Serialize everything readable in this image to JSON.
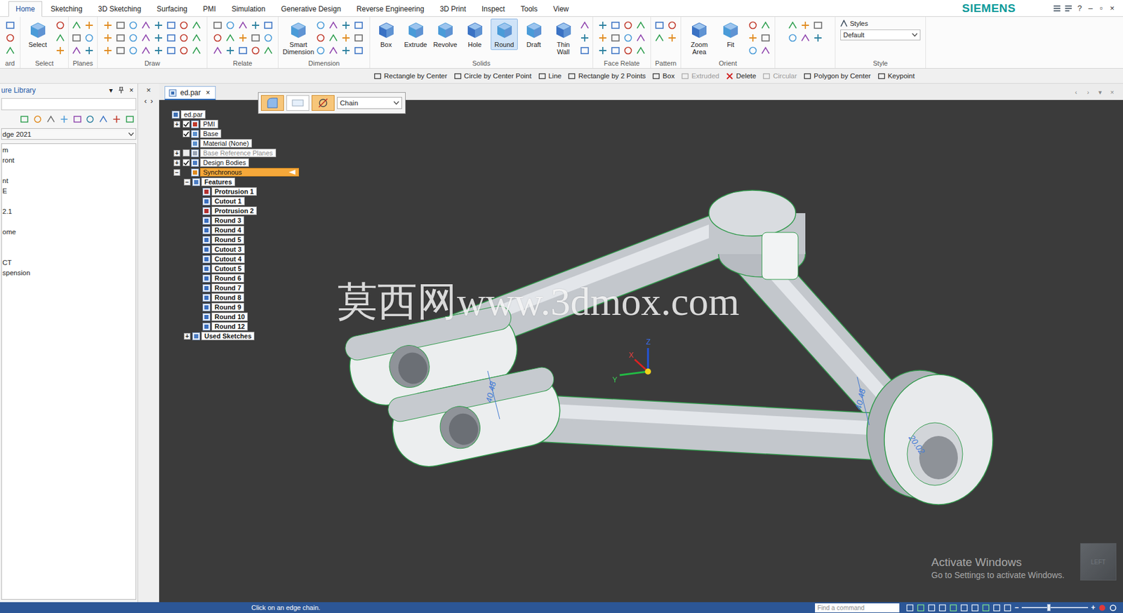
{
  "window": {
    "brand": "SIEMENS",
    "controls": [
      "?",
      "–",
      "▫",
      "×"
    ]
  },
  "ribbon_tabs": [
    {
      "label": "Home",
      "selected": true
    },
    {
      "label": "Sketching",
      "selected": false
    },
    {
      "label": "3D Sketching",
      "selected": false
    },
    {
      "label": "Surfacing",
      "selected": false
    },
    {
      "label": "PMI",
      "selected": false
    },
    {
      "label": "Simulation",
      "selected": false
    },
    {
      "label": "Generative Design",
      "selected": false
    },
    {
      "label": "Reverse Engineering",
      "selected": false
    },
    {
      "label": "3D Print",
      "selected": false
    },
    {
      "label": "Inspect",
      "selected": false
    },
    {
      "label": "Tools",
      "selected": false
    },
    {
      "label": "View",
      "selected": false
    }
  ],
  "ribbon_groups": [
    {
      "label": "ard",
      "buttons": []
    },
    {
      "label": "Select",
      "buttons": [
        {
          "label": "Select",
          "selected": false
        }
      ]
    },
    {
      "label": "Planes",
      "buttons": []
    },
    {
      "label": "Draw",
      "buttons": []
    },
    {
      "label": "Relate",
      "buttons": []
    },
    {
      "label": "Dimension",
      "buttons": [
        {
          "label": "Smart Dimension",
          "selected": false
        }
      ]
    },
    {
      "label": "Solids",
      "buttons": [
        {
          "label": "Box",
          "selected": false
        },
        {
          "label": "Extrude",
          "selected": false
        },
        {
          "label": "Revolve",
          "selected": false
        },
        {
          "label": "Hole",
          "selected": false
        },
        {
          "label": "Round",
          "selected": true
        },
        {
          "label": "Draft",
          "selected": false
        },
        {
          "label": "Thin Wall",
          "selected": false
        }
      ]
    },
    {
      "label": "Face Relate",
      "buttons": []
    },
    {
      "label": "Pattern",
      "buttons": []
    },
    {
      "label": "Orient",
      "buttons": [
        {
          "label": "Zoom Area",
          "selected": false
        },
        {
          "label": "Fit",
          "selected": false
        }
      ]
    },
    {
      "label": "",
      "buttons": []
    }
  ],
  "style_group": {
    "label": "Style",
    "caption": "Styles",
    "value": "Default"
  },
  "command_bar": [
    {
      "label": "Rectangle by Center",
      "disabled": false
    },
    {
      "label": "Circle by Center Point",
      "disabled": false
    },
    {
      "label": "Line",
      "disabled": false
    },
    {
      "label": "Rectangle by 2 Points",
      "disabled": false
    },
    {
      "label": "Box",
      "disabled": false
    },
    {
      "label": "Extruded",
      "disabled": true
    },
    {
      "label": "Delete",
      "disabled": false
    },
    {
      "label": "Circular",
      "disabled": true
    },
    {
      "label": "Polygon by Center",
      "disabled": false
    },
    {
      "label": "Keypoint",
      "disabled": false
    }
  ],
  "library_panel": {
    "title": "ure Library",
    "controls": [
      "▾",
      "×"
    ],
    "dropdown": "dge 2021",
    "items": [
      "m",
      "ront",
      "",
      "nt",
      "E",
      "",
      "2.1",
      "",
      "ome",
      "",
      "",
      "CT",
      "spension"
    ]
  },
  "side_strip": [
    "×",
    "‹",
    "›"
  ],
  "document_tab": {
    "label": "ed.par",
    "close": "×",
    "controls": [
      "‹",
      "›",
      "▾",
      "×"
    ]
  },
  "quickbar": {
    "chain": "Chain"
  },
  "tree": [
    {
      "label": "ed.par",
      "level": 0,
      "expander": null,
      "checked": null,
      "kind": "document",
      "selected": false
    },
    {
      "label": "PMI",
      "level": 1,
      "expander": "+",
      "checked": true,
      "kind": "pmi",
      "selected": false
    },
    {
      "label": "Base",
      "level": 1,
      "expander": null,
      "checked": true,
      "kind": "base",
      "selected": false
    },
    {
      "label": "Material (None)",
      "level": 1,
      "expander": null,
      "checked": null,
      "kind": "material",
      "selected": false
    },
    {
      "label": "Base Reference Planes",
      "level": 1,
      "expander": "+",
      "checked": false,
      "kind": "planes",
      "selected": false,
      "dimmed": true
    },
    {
      "label": "Design Bodies",
      "level": 1,
      "expander": "+",
      "checked": true,
      "kind": "bodies",
      "selected": false
    },
    {
      "label": "Synchronous",
      "level": 1,
      "expander": "−",
      "checked": null,
      "kind": "synchronous",
      "selected": true
    },
    {
      "label": "Features",
      "level": 2,
      "expander": "−",
      "checked": null,
      "kind": "folder",
      "selected": false
    },
    {
      "label": "Protrusion 1",
      "level": 3,
      "expander": null,
      "checked": null,
      "kind": "protrusion",
      "selected": false
    },
    {
      "label": "Cutout 1",
      "level": 3,
      "expander": null,
      "checked": null,
      "kind": "cutout",
      "selected": false
    },
    {
      "label": "Protrusion 2",
      "level": 3,
      "expander": null,
      "checked": null,
      "kind": "protrusion",
      "selected": false
    },
    {
      "label": "Round 3",
      "level": 3,
      "expander": null,
      "checked": null,
      "kind": "round",
      "selected": false
    },
    {
      "label": "Round 4",
      "level": 3,
      "expander": null,
      "checked": null,
      "kind": "round",
      "selected": false
    },
    {
      "label": "Round 5",
      "level": 3,
      "expander": null,
      "checked": null,
      "kind": "round",
      "selected": false
    },
    {
      "label": "Cutout 3",
      "level": 3,
      "expander": null,
      "checked": null,
      "kind": "cutout",
      "selected": false
    },
    {
      "label": "Cutout 4",
      "level": 3,
      "expander": null,
      "checked": null,
      "kind": "cutout",
      "selected": false
    },
    {
      "label": "Cutout 5",
      "level": 3,
      "expander": null,
      "checked": null,
      "kind": "cutout",
      "selected": false
    },
    {
      "label": "Round 6",
      "level": 3,
      "expander": null,
      "checked": null,
      "kind": "round",
      "selected": false
    },
    {
      "label": "Round 7",
      "level": 3,
      "expander": null,
      "checked": null,
      "kind": "round",
      "selected": false
    },
    {
      "label": "Round 8",
      "level": 3,
      "expander": null,
      "checked": null,
      "kind": "round",
      "selected": false
    },
    {
      "label": "Round 9",
      "level": 3,
      "expander": null,
      "checked": null,
      "kind": "round",
      "selected": false
    },
    {
      "label": "Round 10",
      "level": 3,
      "expander": null,
      "checked": null,
      "kind": "round",
      "selected": false
    },
    {
      "label": "Round 12",
      "level": 3,
      "expander": null,
      "checked": null,
      "kind": "round",
      "selected": false
    },
    {
      "label": "Used Sketches",
      "level": 2,
      "expander": "+",
      "checked": null,
      "kind": "folder",
      "selected": false
    }
  ],
  "dimensions": [
    "40.48",
    "40.48",
    "20.02"
  ],
  "triad": {
    "x": "X",
    "y": "Y",
    "z": "Z"
  },
  "watermark": "莫西网www.3dmox.com",
  "activation": {
    "title": "Activate Windows",
    "subtitle": "Go to Settings to activate Windows."
  },
  "view_cube": "LEFT",
  "status_bar": {
    "message": "Click on an edge chain.",
    "search_placeholder": "Find a command",
    "zoom_minus": "−",
    "zoom_plus": "+",
    "zoom_level": 0.38
  }
}
